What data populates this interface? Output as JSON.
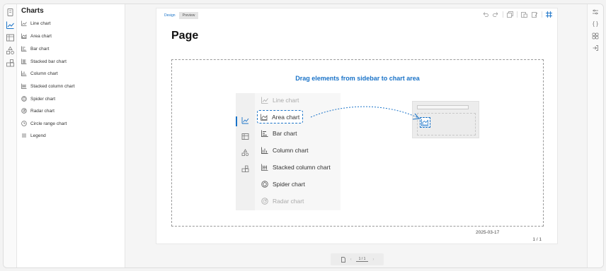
{
  "sidebar": {
    "title": "Charts",
    "items": [
      {
        "label": "Line chart",
        "icon": "line-chart-icon"
      },
      {
        "label": "Area chart",
        "icon": "area-chart-icon"
      },
      {
        "label": "Bar chart",
        "icon": "bar-chart-icon"
      },
      {
        "label": "Stacked bar chart",
        "icon": "stacked-bar-chart-icon"
      },
      {
        "label": "Column chart",
        "icon": "column-chart-icon"
      },
      {
        "label": "Stacked column chart",
        "icon": "stacked-column-chart-icon"
      },
      {
        "label": "Spider chart",
        "icon": "spider-chart-icon"
      },
      {
        "label": "Radar chart",
        "icon": "radar-chart-icon"
      },
      {
        "label": "Circle range chart",
        "icon": "circle-range-chart-icon"
      },
      {
        "label": "Legend",
        "icon": "legend-icon"
      }
    ]
  },
  "tabs": [
    {
      "label": "Design",
      "active": true
    },
    {
      "label": "Preview",
      "active": false
    }
  ],
  "page": {
    "title": "Page",
    "drop_hint": "Drag elements from sidebar to chart area",
    "date": "2025-03-17",
    "page_count": "1 / 1"
  },
  "illustration": {
    "items": [
      {
        "label": "Line chart"
      },
      {
        "label": "Area chart"
      },
      {
        "label": "Bar chart"
      },
      {
        "label": "Column chart"
      },
      {
        "label": "Stacked column chart"
      },
      {
        "label": "Spider chart"
      },
      {
        "label": "Radar chart"
      }
    ]
  },
  "pager": {
    "value": "1 / 1"
  },
  "colors": {
    "accent": "#1a73c8"
  }
}
